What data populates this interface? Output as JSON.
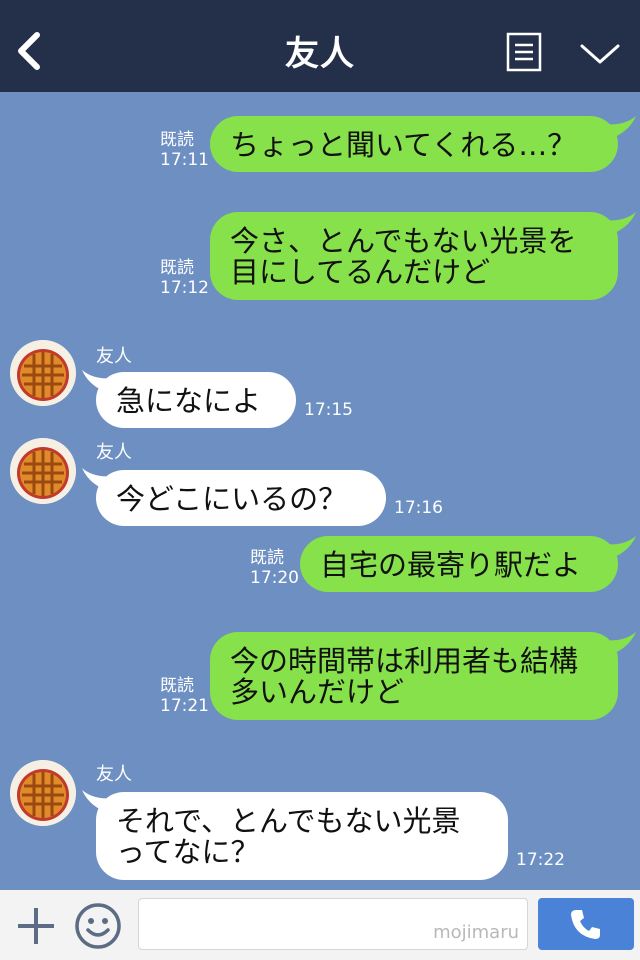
{
  "header": {
    "title": "友人",
    "back_icon": "chevron-left-icon",
    "menu_icon": "menu-list-icon",
    "collapse_icon": "chevron-down-icon"
  },
  "contact_name": "友人",
  "messages": [
    {
      "dir": "out",
      "text": "ちょっと聞いてくれる…？",
      "read": "既読",
      "time": "17:11"
    },
    {
      "dir": "out",
      "text": "今さ、とんでもない光景を\n目にしてるんだけど",
      "read": "既読",
      "time": "17:12"
    },
    {
      "dir": "in",
      "sender": "友人",
      "text": "急になによ",
      "time": "17:15"
    },
    {
      "dir": "in",
      "sender": "友人",
      "text": "今どこにいるの？",
      "time": "17:16"
    },
    {
      "dir": "out",
      "text": "自宅の最寄り駅だよ",
      "read": "既読",
      "time": "17:20"
    },
    {
      "dir": "out",
      "text": "今の時間帯は利用者も結構\n多いんだけど",
      "read": "既読",
      "time": "17:21"
    },
    {
      "dir": "in",
      "sender": "友人",
      "text": "それで、とんでもない光景\nってなに？",
      "time": "17:22"
    }
  ],
  "footer": {
    "input_value": "",
    "watermark": "mojimaru",
    "plus_icon": "plus-icon",
    "emoji_icon": "smiley-icon",
    "call_icon": "phone-icon"
  },
  "colors": {
    "header_bg": "#243049",
    "chat_bg": "#6d8fc2",
    "outgoing_bubble": "#86e14b",
    "incoming_bubble": "#ffffff",
    "call_button": "#4a82d8"
  }
}
